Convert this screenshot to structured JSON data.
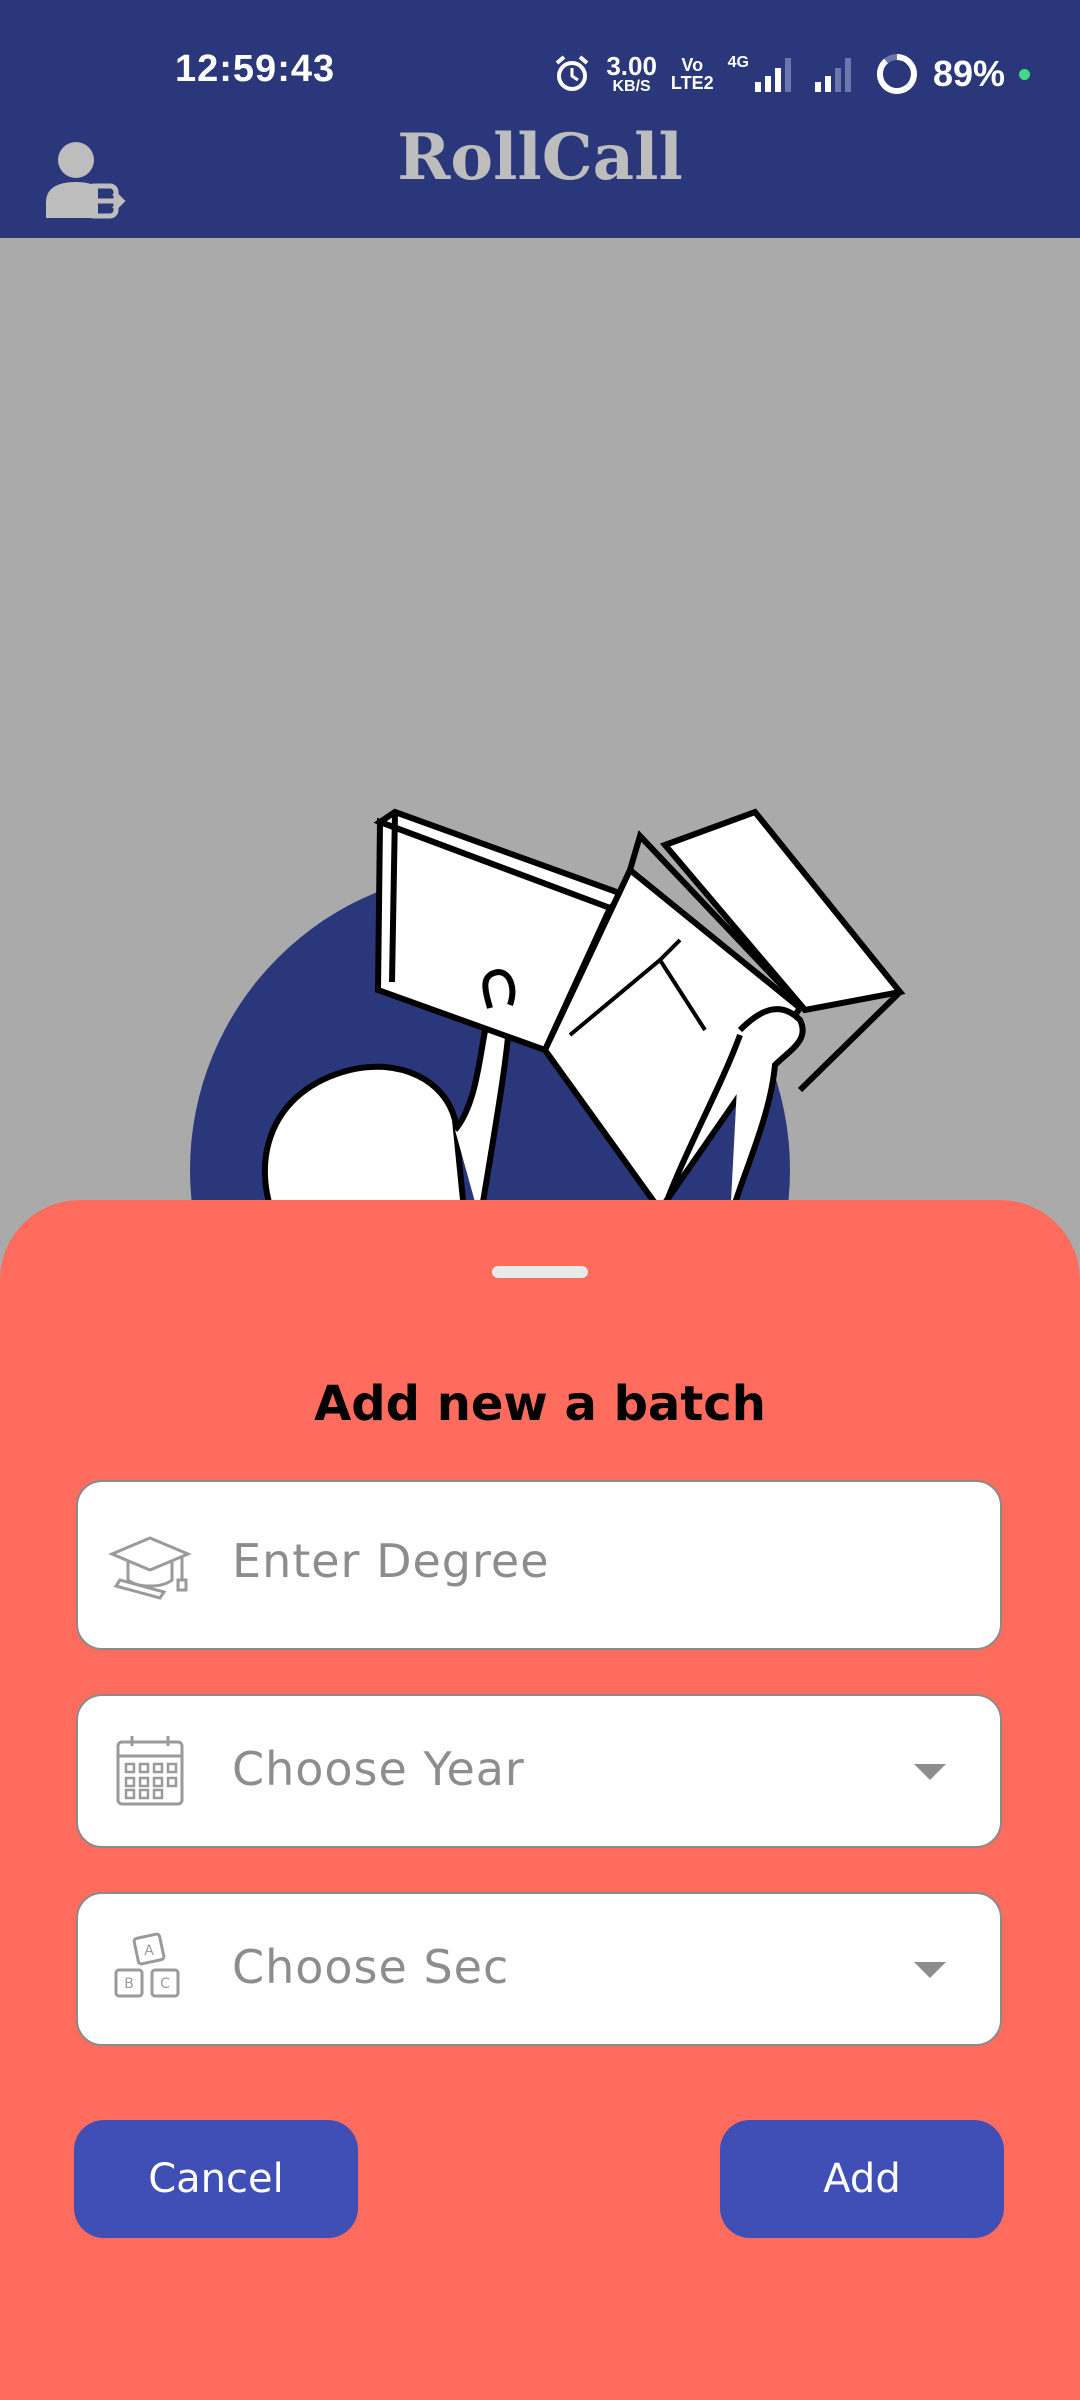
{
  "status_bar": {
    "time": "12:59:43",
    "net_speed_value": "3.00",
    "net_speed_unit": "KB/S",
    "volte_top": "Vo",
    "volte_bottom": "LTE2",
    "network_type": "4G",
    "battery_percent": "89%",
    "icons": [
      "alarm-icon",
      "signal-icon",
      "battery-ring-icon"
    ]
  },
  "app_bar": {
    "title": "RollCall",
    "logout_icon": "user-logout-icon"
  },
  "illustration": {
    "accent_color": "#2a377b"
  },
  "sheet": {
    "title": "Add new a batch",
    "degree_field": {
      "icon": "graduation-cap-icon",
      "placeholder": "Enter Degree"
    },
    "year_select": {
      "icon": "calendar-icon",
      "placeholder": "Choose Year"
    },
    "sec_select": {
      "icon": "abc-blocks-icon",
      "placeholder": "Choose Sec"
    },
    "cancel_label": "Cancel",
    "add_label": "Add"
  },
  "colors": {
    "app_bar": "#2a377b",
    "background": "#aaaaaa",
    "sheet": "#ff6b5d",
    "button": "#3f4fb5"
  }
}
